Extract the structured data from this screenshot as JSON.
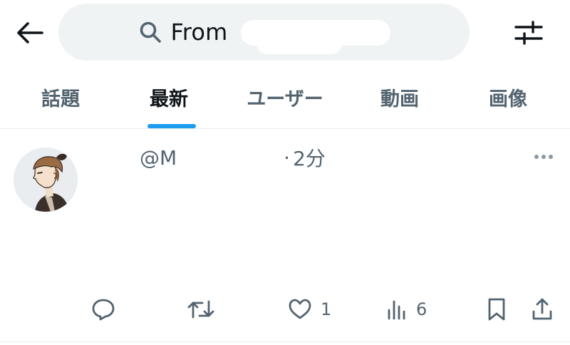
{
  "search": {
    "query": "From"
  },
  "tabs": [
    {
      "label": "話題",
      "active": false
    },
    {
      "label": "最新",
      "active": true
    },
    {
      "label": "ユーザー",
      "active": false
    },
    {
      "label": "動画",
      "active": false
    },
    {
      "label": "画像",
      "active": false
    }
  ],
  "post": {
    "handle_prefix": "@M",
    "time_separator": "·",
    "time_ago": "2分",
    "actions": {
      "reply": "",
      "repost": "",
      "like": "1",
      "views": "6"
    }
  },
  "colors": {
    "accent": "#1d9bf0",
    "text_primary": "#0f1419",
    "text_secondary": "#536471",
    "search_bg": "#eff3f4"
  },
  "icons": [
    "back-arrow-icon",
    "search-icon",
    "filter-sliders-icon",
    "more-icon",
    "reply-icon",
    "repost-icon",
    "like-icon",
    "views-icon",
    "bookmark-icon",
    "share-icon"
  ]
}
